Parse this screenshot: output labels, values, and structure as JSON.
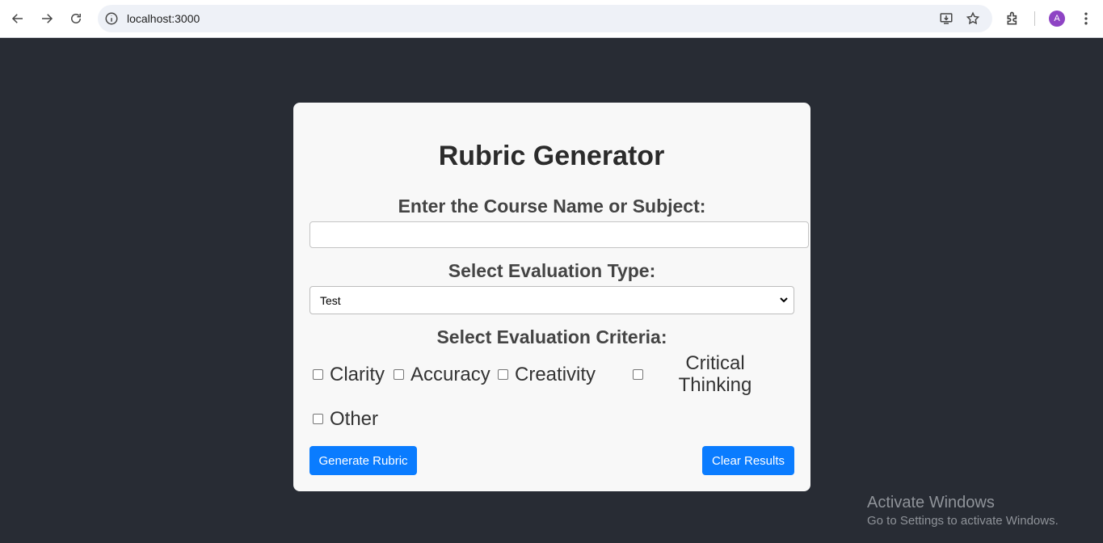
{
  "browser": {
    "url": "localhost:3000",
    "avatar_letter": "A"
  },
  "card": {
    "title": "Rubric Generator",
    "course_label": "Enter the Course Name or Subject:",
    "course_value": "",
    "eval_type_label": "Select Evaluation Type:",
    "eval_type_selected": "Test",
    "criteria_label": "Select Evaluation Criteria:",
    "criteria": [
      {
        "label": "Clarity",
        "checked": false
      },
      {
        "label": "Accuracy",
        "checked": false
      },
      {
        "label": "Creativity",
        "checked": false
      },
      {
        "label": "Critical Thinking",
        "line1": "Critical",
        "line2": "Thinking",
        "checked": false
      },
      {
        "label": "Other",
        "checked": false
      }
    ],
    "generate_button": "Generate Rubric",
    "clear_button": "Clear Results"
  },
  "watermark": {
    "line1": "Activate Windows",
    "line2": "Go to Settings to activate Windows."
  },
  "colors": {
    "background": "#282c34",
    "card": "#f8f8f8",
    "button": "#0a7cff"
  }
}
